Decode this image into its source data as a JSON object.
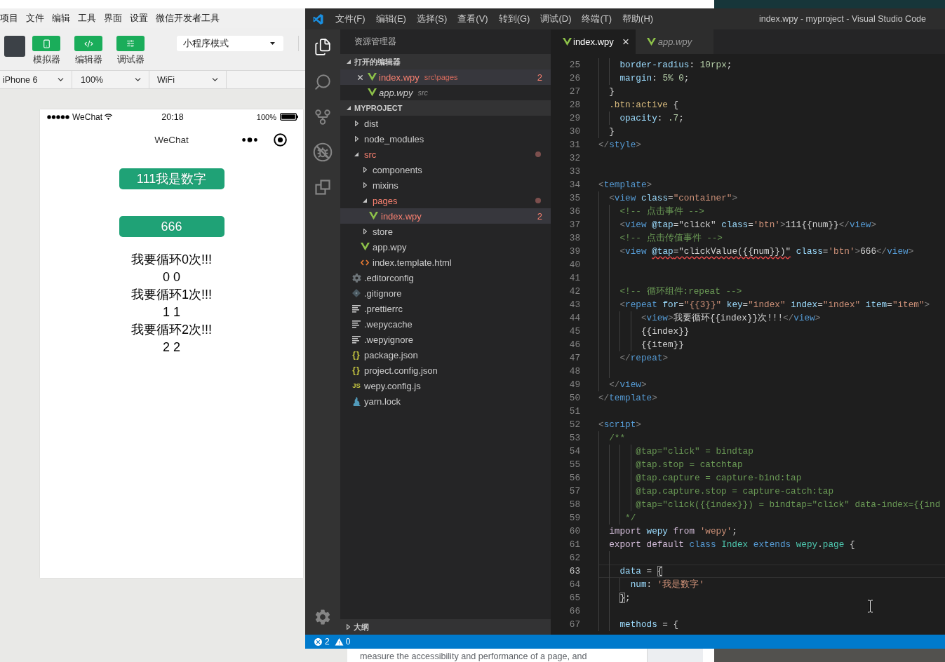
{
  "wechat_devtools": {
    "menu": [
      "项目",
      "文件",
      "编辑",
      "工具",
      "界面",
      "设置",
      "微信开发者工具"
    ],
    "toolbar": {
      "buttons": [
        {
          "kind": "simulator",
          "label": "模拟器"
        },
        {
          "kind": "editor",
          "label": "编辑器"
        },
        {
          "kind": "debugger",
          "label": "调试器"
        }
      ],
      "mode_select": "小程序模式"
    },
    "device_bar": [
      "iPhone 6",
      "100%",
      "WiFi"
    ],
    "phone": {
      "status_bar": {
        "carrier": "WeChat",
        "time": "20:18",
        "battery": "100%"
      },
      "nav_title": "WeChat",
      "buttons": [
        "111我是数字",
        "666"
      ],
      "lines": [
        "我要循环0次!!!",
        "0 0",
        "我要循环1次!!!",
        "1 1",
        "我要循环2次!!!",
        "2 2"
      ]
    }
  },
  "vscode": {
    "menu": [
      "文件(F)",
      "编辑(E)",
      "选择(S)",
      "查看(V)",
      "转到(G)",
      "调试(D)",
      "终端(T)",
      "帮助(H)"
    ],
    "title": "index.wpy - myproject - Visual Studio Code",
    "activity_bar": {
      "items": [
        {
          "kind": "explorer",
          "selected": true
        },
        {
          "kind": "search",
          "selected": false
        },
        {
          "kind": "source_control",
          "selected": false
        },
        {
          "kind": "debug",
          "selected": false
        },
        {
          "kind": "extensions",
          "selected": false
        }
      ],
      "bottom": [
        {
          "kind": "settings",
          "selected": false
        }
      ]
    },
    "sidebar": {
      "title": "资源管理器",
      "open_editors": {
        "title": "打开的编辑器",
        "expanded": true,
        "items": [
          {
            "name": "index.wpy",
            "path": "src\\pages",
            "kind": "vue",
            "selected": true,
            "preview": false,
            "error": true,
            "problems": "2"
          },
          {
            "name": "app.wpy",
            "path": "src",
            "kind": "vue",
            "selected": false,
            "preview": true,
            "error": false
          }
        ]
      },
      "project": {
        "title": "MYPROJECT",
        "expanded": true,
        "tree": [
          {
            "name": "dist",
            "kind": "folder",
            "expanded": false,
            "selected": false,
            "error": false
          },
          {
            "name": "node_modules",
            "kind": "folder",
            "expanded": false,
            "selected": false,
            "error": false
          },
          {
            "name": "src",
            "kind": "folder",
            "expanded": true,
            "selected": false,
            "error": true,
            "children": [
              {
                "name": "components",
                "kind": "folder",
                "expanded": false,
                "selected": false,
                "error": false
              },
              {
                "name": "mixins",
                "kind": "folder",
                "expanded": false,
                "selected": false,
                "error": false
              },
              {
                "name": "pages",
                "kind": "folder",
                "expanded": true,
                "selected": false,
                "error": true,
                "children": [
                  {
                    "name": "index.wpy",
                    "kind": "vue",
                    "selected": true,
                    "error": true,
                    "problems": "2"
                  }
                ]
              },
              {
                "name": "store",
                "kind": "folder",
                "expanded": false,
                "selected": false,
                "error": false
              },
              {
                "name": "app.wpy",
                "kind": "vue",
                "selected": false,
                "error": false
              },
              {
                "name": "index.template.html",
                "kind": "html",
                "selected": false,
                "error": false
              }
            ]
          },
          {
            "name": ".editorconfig",
            "kind": "config",
            "selected": false,
            "error": false
          },
          {
            "name": ".gitignore",
            "kind": "git",
            "selected": false,
            "error": false
          },
          {
            "name": ".prettierrc",
            "kind": "lines",
            "selected": false,
            "error": false
          },
          {
            "name": ".wepycache",
            "kind": "lines",
            "selected": false,
            "error": false
          },
          {
            "name": ".wepyignore",
            "kind": "lines",
            "selected": false,
            "error": false
          },
          {
            "name": "package.json",
            "kind": "json",
            "glyph": "{}",
            "selected": false,
            "error": false
          },
          {
            "name": "project.config.json",
            "kind": "json",
            "glyph": "{}",
            "selected": false,
            "error": false
          },
          {
            "name": "wepy.config.js",
            "kind": "js",
            "glyph": "JS",
            "selected": false,
            "error": false
          },
          {
            "name": "yarn.lock",
            "kind": "yarn",
            "selected": false,
            "error": false
          }
        ]
      },
      "outline": {
        "title": "大纲",
        "expanded": false
      }
    },
    "tabs": [
      {
        "label": "index.wpy",
        "kind": "vue",
        "selected": true,
        "preview": false
      },
      {
        "label": "app.wpy",
        "kind": "vue",
        "selected": false,
        "preview": true
      }
    ],
    "editor": {
      "lines": [
        {
          "number": "25",
          "current": false,
          "tokens": [
            {
              "kind": "prop",
              "text": "    border-radius"
            },
            {
              "kind": "text",
              "text": ": "
            },
            {
              "kind": "number",
              "text": "10rpx"
            },
            {
              "kind": "text",
              "text": ";"
            }
          ]
        },
        {
          "number": "26",
          "current": false,
          "tokens": [
            {
              "kind": "prop",
              "text": "    margin"
            },
            {
              "kind": "text",
              "text": ": "
            },
            {
              "kind": "number",
              "text": "5% 0"
            },
            {
              "kind": "text",
              "text": ";"
            }
          ]
        },
        {
          "number": "27",
          "current": false,
          "tokens": [
            {
              "kind": "text",
              "text": "  }"
            }
          ]
        },
        {
          "number": "28",
          "current": false,
          "tokens": [
            {
              "kind": "selector",
              "text": "  .btn:active"
            },
            {
              "kind": "text",
              "text": " {"
            }
          ]
        },
        {
          "number": "29",
          "current": false,
          "tokens": [
            {
              "kind": "prop",
              "text": "    opacity"
            },
            {
              "kind": "text",
              "text": ": "
            },
            {
              "kind": "number",
              "text": ".7"
            },
            {
              "kind": "text",
              "text": ";"
            }
          ]
        },
        {
          "number": "30",
          "current": false,
          "tokens": [
            {
              "kind": "text",
              "text": "  }"
            }
          ]
        },
        {
          "number": "31",
          "current": false,
          "tokens": [
            {
              "kind": "punct",
              "text": "</"
            },
            {
              "kind": "tag",
              "text": "style"
            },
            {
              "kind": "punct",
              "text": ">"
            }
          ]
        },
        {
          "number": "32",
          "current": false
        },
        {
          "number": "33",
          "current": false
        },
        {
          "number": "34",
          "current": false,
          "tokens": [
            {
              "kind": "punct",
              "text": "<"
            },
            {
              "kind": "tag",
              "text": "template"
            },
            {
              "kind": "punct",
              "text": ">"
            }
          ]
        },
        {
          "number": "35",
          "current": false,
          "tokens": [
            {
              "kind": "punct",
              "text": "  <"
            },
            {
              "kind": "tag",
              "text": "view "
            },
            {
              "kind": "attr",
              "text": "class"
            },
            {
              "kind": "text",
              "text": "="
            },
            {
              "kind": "string",
              "text": "\"container\""
            },
            {
              "kind": "punct",
              "text": ">"
            }
          ]
        },
        {
          "number": "36",
          "current": false,
          "tokens": [
            {
              "kind": "comment",
              "text": "    <!-- 点击事件 -->"
            }
          ]
        },
        {
          "number": "37",
          "current": false,
          "tokens": [
            {
              "kind": "punct",
              "text": "    <"
            },
            {
              "kind": "tag",
              "text": "view "
            },
            {
              "kind": "attr",
              "text": "@tap"
            },
            {
              "kind": "text",
              "text": "=\"click\" "
            },
            {
              "kind": "attr",
              "text": "class"
            },
            {
              "kind": "text",
              "text": "="
            },
            {
              "kind": "string",
              "text": "'btn'"
            },
            {
              "kind": "punct",
              "text": ">"
            },
            {
              "kind": "text",
              "text": "111{{num}}"
            },
            {
              "kind": "punct",
              "text": "</"
            },
            {
              "kind": "tag",
              "text": "view"
            },
            {
              "kind": "punct",
              "text": ">"
            }
          ]
        },
        {
          "number": "38",
          "current": false,
          "tokens": [
            {
              "kind": "comment",
              "text": "    <!-- 点击传值事件 -->"
            }
          ]
        },
        {
          "number": "39",
          "current": false,
          "tokens": [
            {
              "kind": "punct",
              "text": "    <"
            },
            {
              "kind": "tag",
              "text": "view "
            },
            {
              "kind": "error",
              "tokens": [
                {
                  "kind": "attr",
                  "text": "@tap"
                },
                {
                  "kind": "text",
                  "text": "=\"clickValue({{num}})\""
                }
              ]
            },
            {
              "kind": "attr",
              "text": " class"
            },
            {
              "kind": "text",
              "text": "="
            },
            {
              "kind": "string",
              "text": "'btn'"
            },
            {
              "kind": "punct",
              "text": ">"
            },
            {
              "kind": "text",
              "text": "666"
            },
            {
              "kind": "punct",
              "text": "</"
            },
            {
              "kind": "tag",
              "text": "view"
            },
            {
              "kind": "punct",
              "text": ">"
            }
          ]
        },
        {
          "number": "40",
          "current": false
        },
        {
          "number": "41",
          "current": false
        },
        {
          "number": "42",
          "current": false,
          "tokens": [
            {
              "kind": "comment",
              "text": "    <!-- 循环组件:repeat -->"
            }
          ]
        },
        {
          "number": "43",
          "current": false,
          "tokens": [
            {
              "kind": "punct",
              "text": "    <"
            },
            {
              "kind": "tag",
              "text": "repeat "
            },
            {
              "kind": "attr",
              "text": "for"
            },
            {
              "kind": "text",
              "text": "="
            },
            {
              "kind": "string",
              "text": "\"{{3}}\" "
            },
            {
              "kind": "attr",
              "text": "key"
            },
            {
              "kind": "text",
              "text": "="
            },
            {
              "kind": "string",
              "text": "\"index\" "
            },
            {
              "kind": "attr",
              "text": "index"
            },
            {
              "kind": "text",
              "text": "="
            },
            {
              "kind": "string",
              "text": "\"index\" "
            },
            {
              "kind": "attr",
              "text": "item"
            },
            {
              "kind": "text",
              "text": "="
            },
            {
              "kind": "string",
              "text": "\"item\""
            },
            {
              "kind": "punct",
              "text": ">"
            }
          ]
        },
        {
          "number": "44",
          "current": false,
          "tokens": [
            {
              "kind": "punct",
              "text": "        <"
            },
            {
              "kind": "tag",
              "text": "view"
            },
            {
              "kind": "punct",
              "text": ">"
            },
            {
              "kind": "text",
              "text": "我要循环{{index}}次!!!"
            },
            {
              "kind": "punct",
              "text": "</"
            },
            {
              "kind": "tag",
              "text": "view"
            },
            {
              "kind": "punct",
              "text": ">"
            }
          ]
        },
        {
          "number": "45",
          "current": false,
          "tokens": [
            {
              "kind": "text",
              "text": "        {{index}}"
            }
          ]
        },
        {
          "number": "46",
          "current": false,
          "tokens": [
            {
              "kind": "text",
              "text": "        {{item}}"
            }
          ]
        },
        {
          "number": "47",
          "current": false,
          "tokens": [
            {
              "kind": "punct",
              "text": "    </"
            },
            {
              "kind": "tag",
              "text": "repeat"
            },
            {
              "kind": "punct",
              "text": ">"
            }
          ]
        },
        {
          "number": "48",
          "current": false
        },
        {
          "number": "49",
          "current": false,
          "tokens": [
            {
              "kind": "punct",
              "text": "  </"
            },
            {
              "kind": "tag",
              "text": "view"
            },
            {
              "kind": "punct",
              "text": ">"
            }
          ]
        },
        {
          "number": "50",
          "current": false,
          "tokens": [
            {
              "kind": "punct",
              "text": "</"
            },
            {
              "kind": "tag",
              "text": "template"
            },
            {
              "kind": "punct",
              "text": ">"
            }
          ]
        },
        {
          "number": "51",
          "current": false
        },
        {
          "number": "52",
          "current": false,
          "tokens": [
            {
              "kind": "punct",
              "text": "<"
            },
            {
              "kind": "tag",
              "text": "script"
            },
            {
              "kind": "punct",
              "text": ">"
            }
          ]
        },
        {
          "number": "53",
          "current": false,
          "tokens": [
            {
              "kind": "comment",
              "text": "  /**"
            }
          ]
        },
        {
          "number": "54",
          "current": false,
          "tokens": [
            {
              "kind": "comment",
              "text": "       @tap=\"click\" = bindtap"
            }
          ]
        },
        {
          "number": "55",
          "current": false,
          "tokens": [
            {
              "kind": "comment",
              "text": "       @tap.stop = catchtap"
            }
          ]
        },
        {
          "number": "56",
          "current": false,
          "tokens": [
            {
              "kind": "comment",
              "text": "       @tap.capture = capture-bind:tap"
            }
          ]
        },
        {
          "number": "57",
          "current": false,
          "tokens": [
            {
              "kind": "comment",
              "text": "       @tap.capture.stop = capture-catch:tap"
            }
          ]
        },
        {
          "number": "58",
          "current": false,
          "tokens": [
            {
              "kind": "comment",
              "text": "       @tap=\"click({{index}}) = bindtap=\"click\" data-index={{ind"
            }
          ]
        },
        {
          "number": "59",
          "current": false,
          "tokens": [
            {
              "kind": "comment",
              "text": "     */"
            }
          ]
        },
        {
          "number": "60",
          "current": false,
          "tokens": [
            {
              "kind": "keyword",
              "text": "  import "
            },
            {
              "kind": "variable",
              "text": "wepy "
            },
            {
              "kind": "keyword",
              "text": "from "
            },
            {
              "kind": "string",
              "text": "'wepy'"
            },
            {
              "kind": "text",
              "text": ";"
            }
          ]
        },
        {
          "number": "61",
          "current": false,
          "tokens": [
            {
              "kind": "keyword",
              "text": "  export default "
            },
            {
              "kind": "storage",
              "text": "class "
            },
            {
              "kind": "class",
              "text": "Index "
            },
            {
              "kind": "storage",
              "text": "extends "
            },
            {
              "kind": "class",
              "text": "wepy"
            },
            {
              "kind": "text",
              "text": "."
            },
            {
              "kind": "class",
              "text": "page"
            },
            {
              "kind": "text",
              "text": " {"
            }
          ]
        },
        {
          "number": "62",
          "current": false
        },
        {
          "number": "63",
          "current": true,
          "tokens": [
            {
              "kind": "variable",
              "text": "    data"
            },
            {
              "kind": "text",
              "text": " = "
            },
            {
              "kind": "bracket",
              "text": "{"
            }
          ]
        },
        {
          "number": "64",
          "current": false,
          "tokens": [
            {
              "kind": "variable",
              "text": "      num"
            },
            {
              "kind": "text",
              "text": ": "
            },
            {
              "kind": "string",
              "text": "'我是数字'"
            }
          ]
        },
        {
          "number": "65",
          "current": false,
          "tokens": [
            {
              "kind": "bracket",
              "text": "    }"
            },
            {
              "kind": "text",
              "text": ";"
            }
          ]
        },
        {
          "number": "66",
          "current": false
        },
        {
          "number": "67",
          "current": false,
          "tokens": [
            {
              "kind": "variable",
              "text": "    methods"
            },
            {
              "kind": "text",
              "text": " = {"
            }
          ]
        }
      ]
    },
    "status_bar": {
      "errors": "2",
      "warnings": "0"
    }
  },
  "browser": {
    "text": "measure the accessibility and performance of a page, and"
  }
}
